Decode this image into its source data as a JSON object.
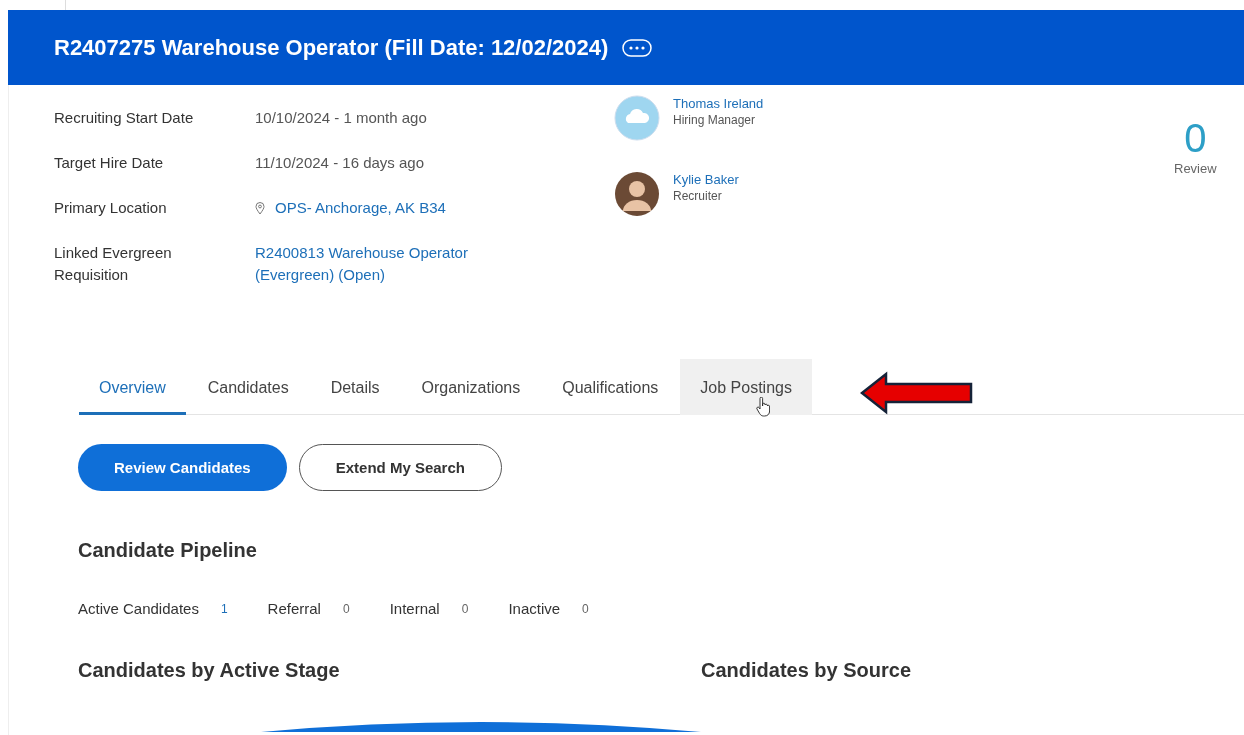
{
  "header": {
    "title": "R2407275 Warehouse Operator (Fill Date: 12/02/2024)"
  },
  "details": [
    {
      "label": "Recruiting Start Date",
      "value": "10/10/2024 - 1 month ago",
      "kind": "text"
    },
    {
      "label": "Target Hire Date",
      "value": "11/10/2024 - 16 days ago",
      "kind": "text"
    },
    {
      "label": "Primary Location",
      "value": "OPS- Anchorage, AK B34",
      "kind": "location"
    },
    {
      "label": "Linked Evergreen Requisition",
      "value": "R2400813 Warehouse Operator (Evergreen) (Open)",
      "kind": "link"
    }
  ],
  "people": [
    {
      "name": "Thomas Ireland",
      "role": "Hiring Manager",
      "kind": "cloud"
    },
    {
      "name": "Kylie Baker",
      "role": "Recruiter",
      "kind": "photo"
    }
  ],
  "review": {
    "count": "0",
    "label": "Review"
  },
  "tabs": [
    {
      "label": "Overview",
      "selected": true,
      "hovered": false
    },
    {
      "label": "Candidates",
      "selected": false,
      "hovered": false
    },
    {
      "label": "Details",
      "selected": false,
      "hovered": false
    },
    {
      "label": "Organizations",
      "selected": false,
      "hovered": false
    },
    {
      "label": "Qualifications",
      "selected": false,
      "hovered": false
    },
    {
      "label": "Job Postings",
      "selected": false,
      "hovered": true
    }
  ],
  "buttons": [
    {
      "label": "Review Candidates",
      "kind": "primary"
    },
    {
      "label": "Extend My Search",
      "kind": "outline"
    }
  ],
  "pipeline": {
    "title": "Candidate Pipeline",
    "counts": [
      {
        "label": "Active Candidates",
        "count": "1",
        "kind": "link"
      },
      {
        "label": "Referral",
        "count": "0",
        "kind": "text"
      },
      {
        "label": "Internal",
        "count": "0",
        "kind": "text"
      },
      {
        "label": "Inactive",
        "count": "0",
        "kind": "text"
      }
    ]
  },
  "sections": [
    {
      "title": "Candidates by Active Stage"
    },
    {
      "title": "Candidates by Source"
    }
  ]
}
